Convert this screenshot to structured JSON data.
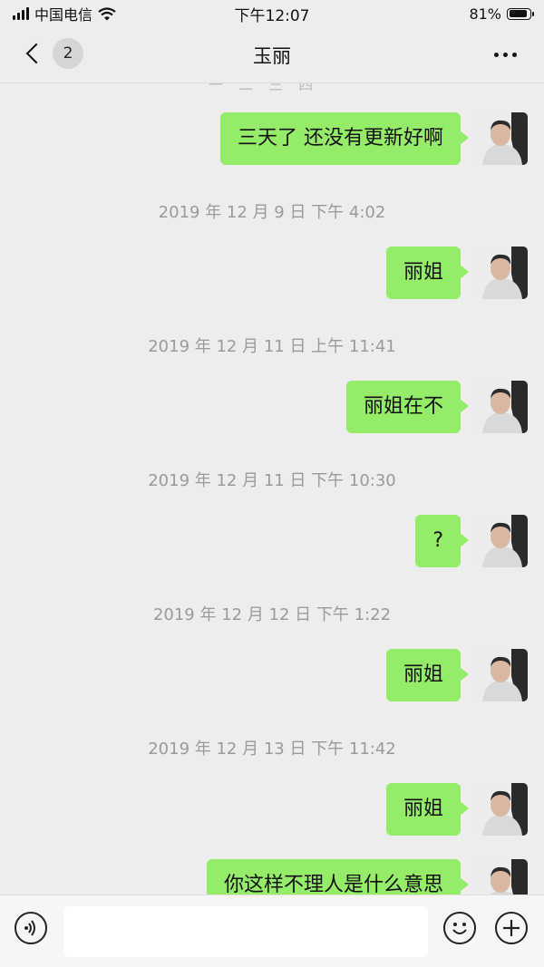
{
  "status_bar": {
    "carrier": "中国电信",
    "time": "下午12:07",
    "battery": "81%",
    "battery_level": 0.81
  },
  "nav": {
    "unread_count": "2",
    "title": "玉丽"
  },
  "messages": [
    {
      "text": "三天了 还没有更新好啊"
    },
    {
      "timestamp": "2019 年 12 月 9 日 下午 4:02",
      "text": "丽姐"
    },
    {
      "timestamp": "2019 年 12 月 11 日 上午 11:41",
      "text": "丽姐在不"
    },
    {
      "timestamp": "2019 年 12 月 11 日 下午 10:30",
      "text": "?"
    },
    {
      "timestamp": "2019 年 12 月 12 日 下午 1:22",
      "text": "丽姐"
    },
    {
      "timestamp": "2019 年 12 月 13 日 下午 11:42",
      "text": "丽姐"
    },
    {
      "text": "你这样不理人是什么意思"
    }
  ],
  "input_bar": {
    "placeholder": "",
    "voice_icon": "voice-icon",
    "emoji_icon": "emoji-icon",
    "plus_icon": "plus-icon"
  }
}
